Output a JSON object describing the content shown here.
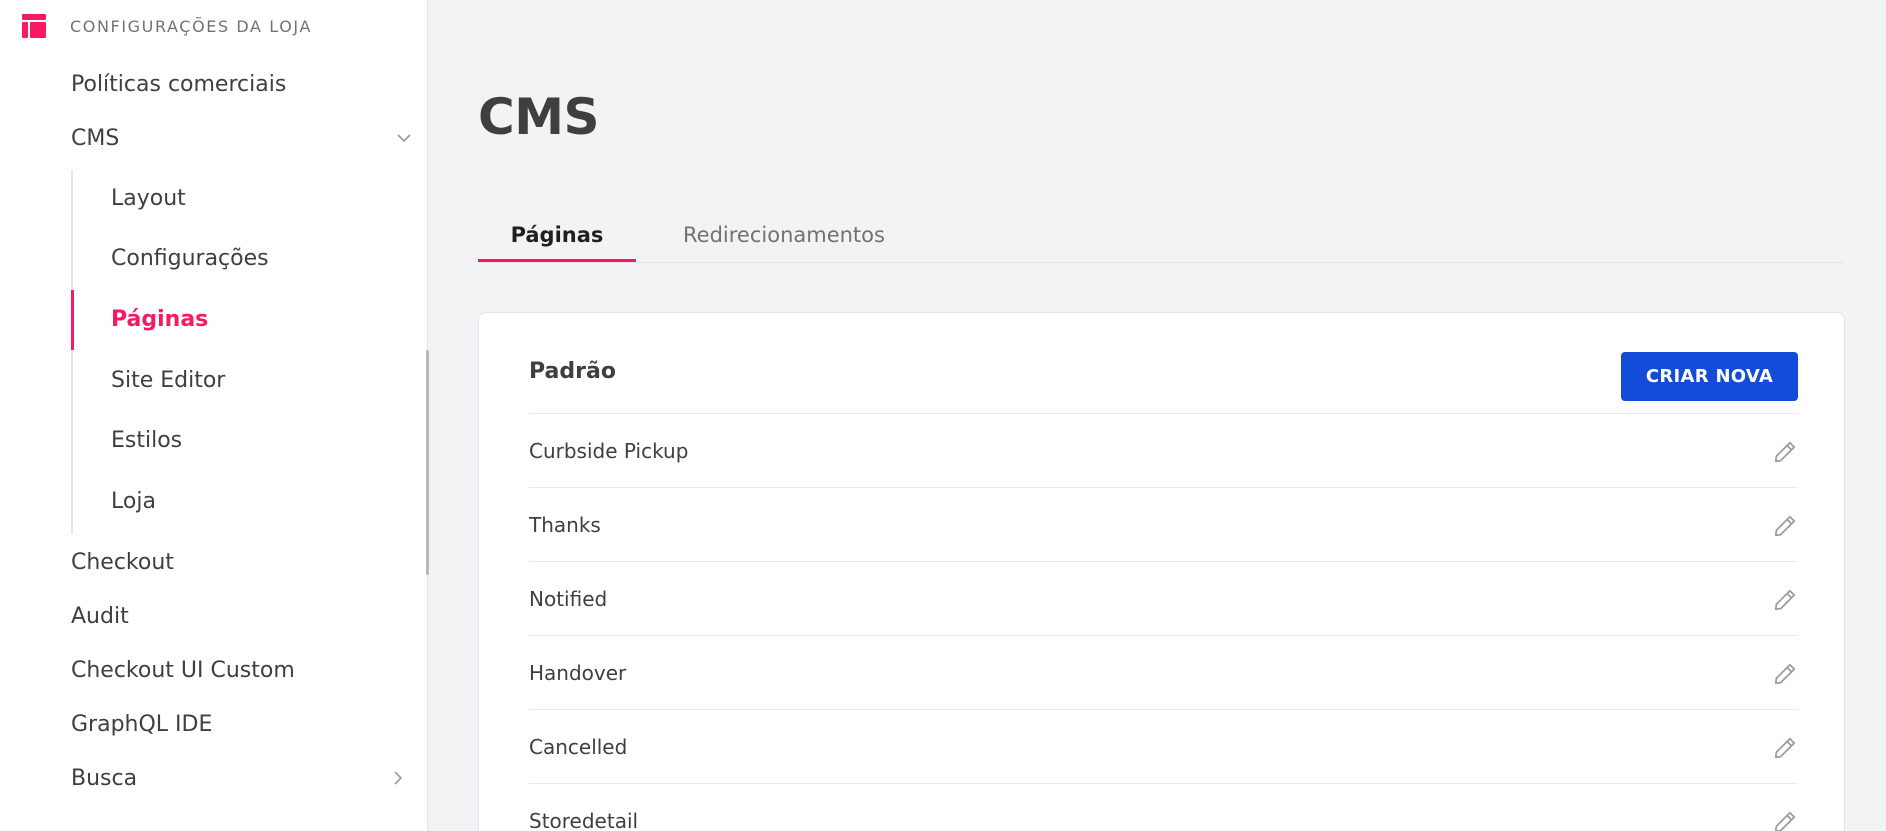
{
  "sidebar": {
    "section_title": "Configurações da loja",
    "items_top": [
      {
        "label": "Políticas comerciais"
      },
      {
        "label": "CMS"
      }
    ],
    "cms_subitems": [
      {
        "label": "Layout"
      },
      {
        "label": "Configurações"
      },
      {
        "label": "Páginas"
      },
      {
        "label": "Site Editor"
      },
      {
        "label": "Estilos"
      },
      {
        "label": "Loja"
      }
    ],
    "items_bottom": [
      {
        "label": "Checkout"
      },
      {
        "label": "Audit"
      },
      {
        "label": "Checkout UI Custom"
      },
      {
        "label": "GraphQL IDE"
      },
      {
        "label": "Busca"
      }
    ],
    "active_item": "Páginas"
  },
  "main": {
    "title": "CMS",
    "tabs": [
      {
        "label": "Páginas"
      },
      {
        "label": "Redirecionamentos"
      }
    ],
    "active_tab": "Páginas",
    "card": {
      "title": "Padrão",
      "create_button_label": "CRIAR NOVA",
      "rows": [
        {
          "label": "Curbside Pickup"
        },
        {
          "label": "Thanks"
        },
        {
          "label": "Notified"
        },
        {
          "label": "Handover"
        },
        {
          "label": "Cancelled"
        },
        {
          "label": "Storedetail"
        }
      ]
    }
  },
  "colors": {
    "accent": "#f71963",
    "primary_button": "#134cd8",
    "text": "#3f3f40",
    "muted": "#727273",
    "page_bg": "#f2f3f5"
  },
  "icons": {
    "section": "store-settings-icon",
    "expand": "chevron-down-icon",
    "collapsed": "chevron-right-icon",
    "edit": "pencil-icon"
  }
}
